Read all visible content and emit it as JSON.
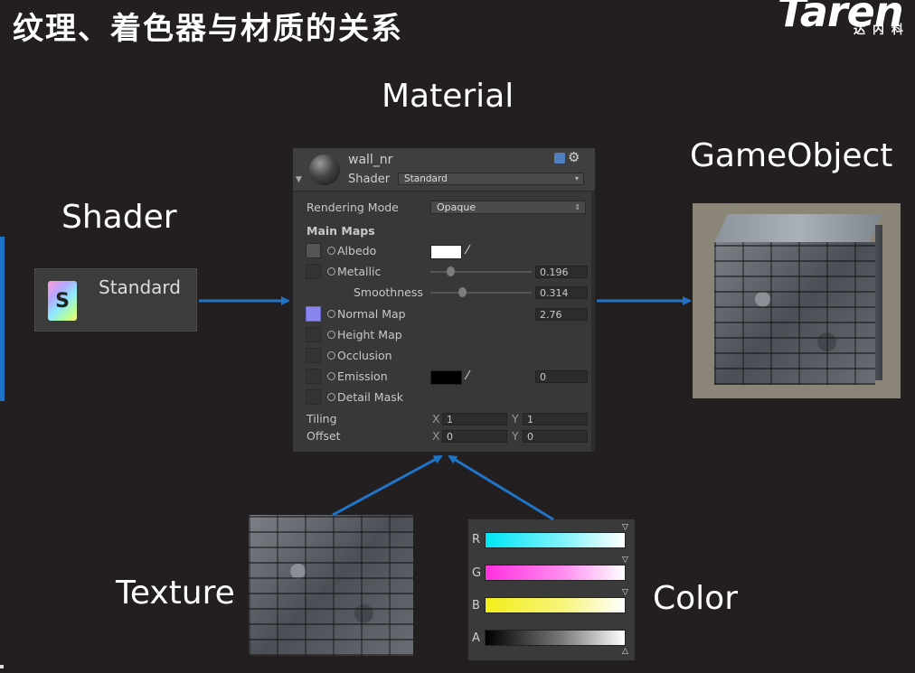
{
  "title": "纹理、着色器与材质的关系",
  "logo": {
    "wordmark": "Taren",
    "subtitle": "达内科"
  },
  "labels": {
    "material": "Material",
    "gameobject": "GameObject",
    "shader": "Shader",
    "texture": "Texture",
    "color": "Color"
  },
  "shader_asset": {
    "name": "Standard",
    "icon_letter": "S"
  },
  "inspector": {
    "material_name": "wall_nr",
    "shader_label": "Shader",
    "shader_value": "Standard",
    "rendering_mode_label": "Rendering Mode",
    "rendering_mode_value": "Opaque",
    "section_main_maps": "Main Maps",
    "albedo": "Albedo",
    "metallic": {
      "label": "Metallic",
      "value": "0.196",
      "level": 0.196
    },
    "smoothness": {
      "label": "Smoothness",
      "value": "0.314",
      "level": 0.314
    },
    "normal_map": {
      "label": "Normal Map",
      "value": "2.76"
    },
    "height_map": "Height Map",
    "occlusion": "Occlusion",
    "emission": {
      "label": "Emission",
      "value": "0"
    },
    "detail_mask": "Detail Mask",
    "tiling": {
      "label": "Tiling",
      "x_label": "X",
      "x": "1",
      "y_label": "Y",
      "y": "1"
    },
    "offset": {
      "label": "Offset",
      "x_label": "X",
      "x": "0",
      "y_label": "Y",
      "y": "0"
    }
  },
  "color_channels": [
    "R",
    "G",
    "B",
    "A"
  ],
  "icons": {
    "gear": "gear-icon",
    "help": "help-icon",
    "sphere": "material-preview-icon",
    "eyedropper": "eyedropper-icon"
  },
  "colors": {
    "arrow": "#1f74c8",
    "albedo": "#ffffff",
    "emission": "#000000",
    "normal_map_slot": "#8a86f0",
    "r": "#00e5f5",
    "g": "#ff30e0",
    "b": "#f2ee1a"
  }
}
